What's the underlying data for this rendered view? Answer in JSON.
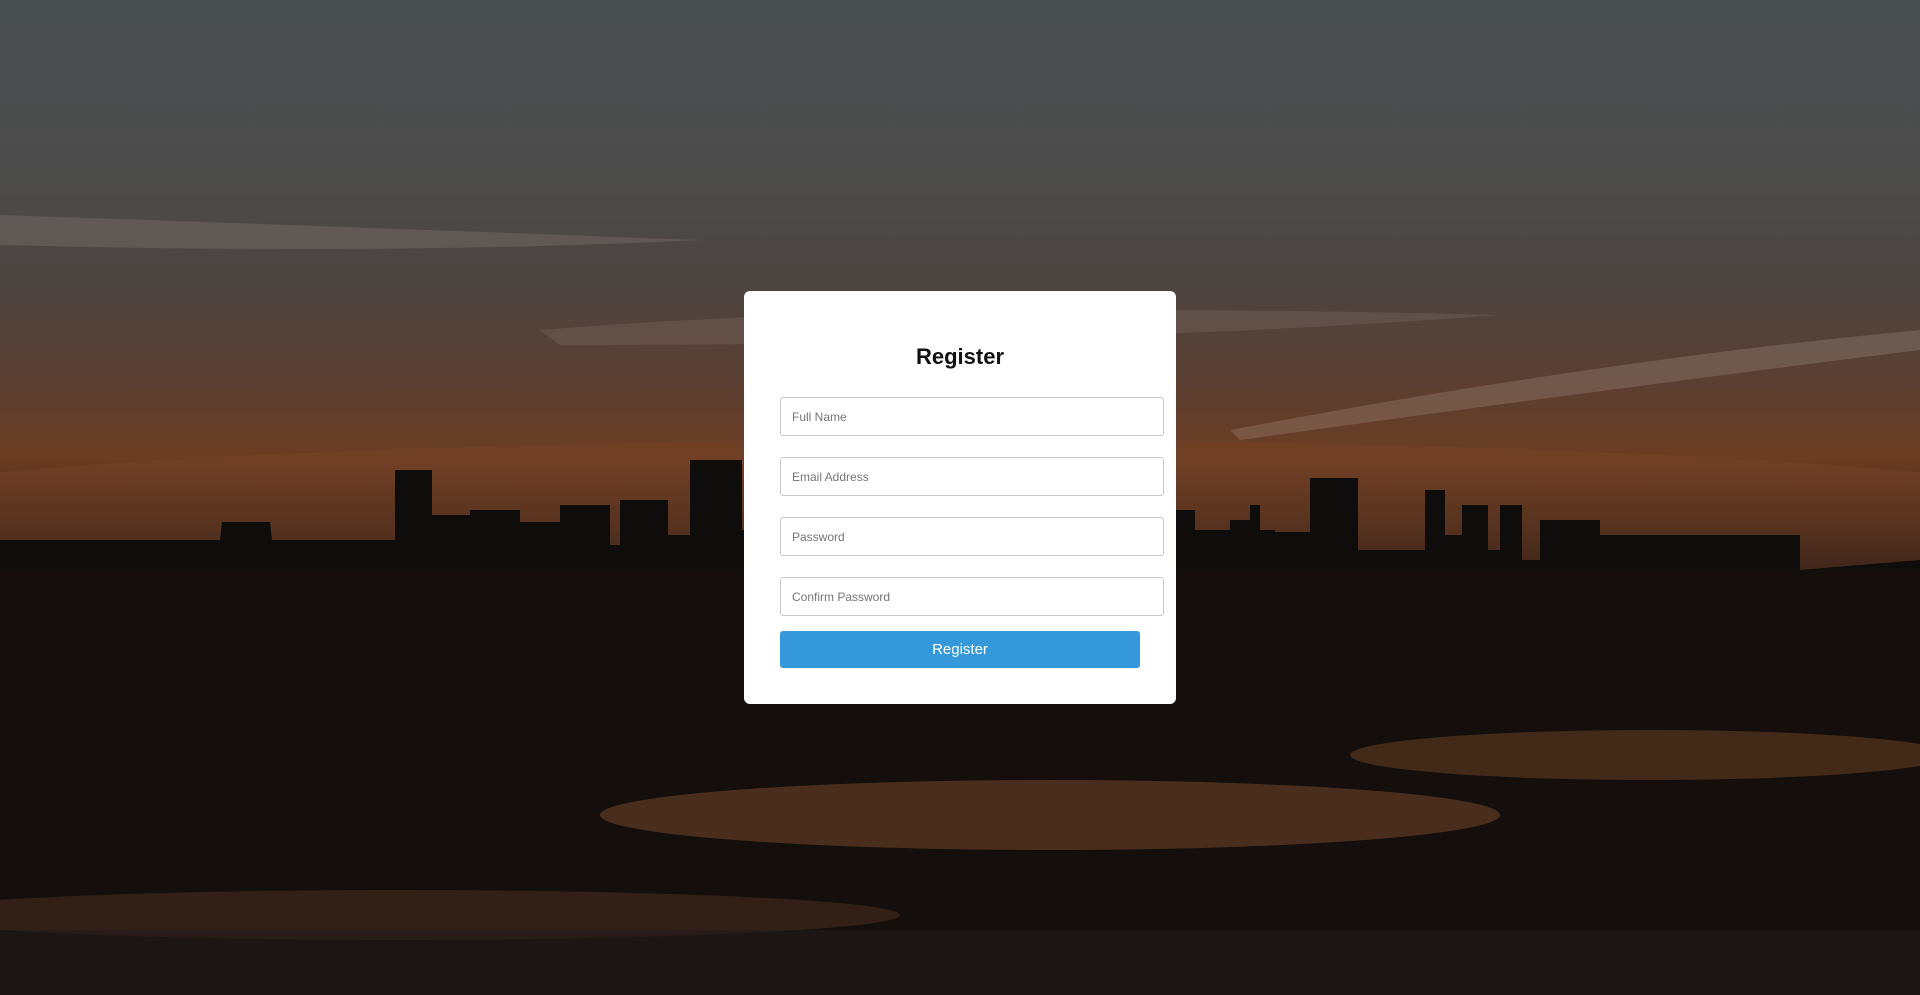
{
  "register_form": {
    "title": "Register",
    "full_name": {
      "value": "",
      "placeholder": "Full Name"
    },
    "email": {
      "value": "",
      "placeholder": "Email Address"
    },
    "password": {
      "value": "",
      "placeholder": "Password"
    },
    "confirm_password": {
      "value": "",
      "placeholder": "Confirm Password"
    },
    "submit_label": "Register"
  },
  "colors": {
    "button": "#3498db",
    "card": "#ffffff",
    "title": "#111111"
  },
  "background": {
    "description_icon": "city-skyline-sunset-image"
  }
}
